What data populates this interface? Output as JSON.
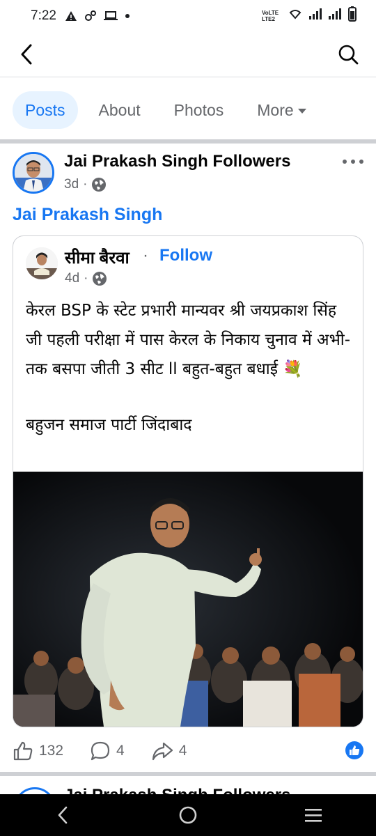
{
  "status_bar": {
    "time": "7:22",
    "network_label": "VoLTE LTE2"
  },
  "tabs": [
    {
      "label": "Posts",
      "active": true
    },
    {
      "label": "About",
      "active": false
    },
    {
      "label": "Photos",
      "active": false
    },
    {
      "label": "More",
      "active": false
    }
  ],
  "post": {
    "page_name": "Jai Prakash Singh Followers",
    "time": "3d",
    "audience_icon": "globe-icon",
    "text_link": "Jai Prakash Singh",
    "shared": {
      "author": "सीमा बैरवा",
      "separator": "·",
      "follow_label": "Follow",
      "time": "4d",
      "audience_icon": "globe-icon",
      "body_line1": "केरल BSP के स्टेट प्रभारी मान्यवर श्री जयप्रकाश सिंह जी पहली परीक्षा में पास केरल के निकाय चुनाव में अभी-तक बसपा जीती 3 सीट ll बहुत-बहुत बधाई 💐",
      "body_line2": "बहुजन समाज पार्टी जिंदाबाद"
    },
    "actions": {
      "likes": "132",
      "comments": "4",
      "shares": "4"
    }
  },
  "next_post": {
    "page_name": "Jai Prakash Singh Followers"
  },
  "colors": {
    "brand_blue": "#1877f2",
    "tab_active_bg": "#e7f3ff",
    "muted": "#65676b"
  }
}
